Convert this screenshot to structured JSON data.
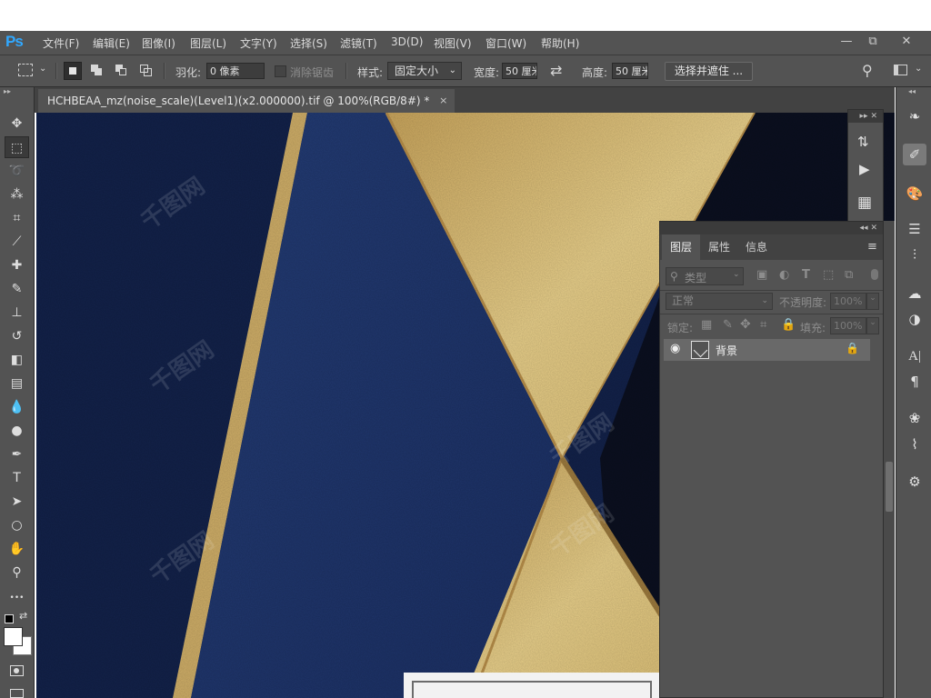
{
  "app": {
    "logo": "Ps"
  },
  "menu": [
    "文件(F)",
    "编辑(E)",
    "图像(I)",
    "图层(L)",
    "文字(Y)",
    "选择(S)",
    "滤镜(T)",
    "3D(D)",
    "视图(V)",
    "窗口(W)",
    "帮助(H)"
  ],
  "window_controls": {
    "minimize": "—",
    "restore": "⧉",
    "close": "✕"
  },
  "options": {
    "feather_label": "羽化:",
    "feather_value": "0 像素",
    "antialias_label": "消除锯齿",
    "style_label": "样式:",
    "style_value": "固定大小",
    "width_label": "宽度:",
    "width_value": "50 厘米",
    "swap_icon": "⇄",
    "height_label": "高度:",
    "height_value": "50 厘米",
    "select_mask_label": "选择并遮住 ..."
  },
  "document": {
    "tab_title": "HCHBEAA_mz(noise_scale)(Level1)(x2.000000).tif @ 100%(RGB/8#) *",
    "close": "×"
  },
  "tools": [
    {
      "name": "move-tool",
      "glyph": "✥"
    },
    {
      "name": "marquee-tool",
      "glyph": "⬚"
    },
    {
      "name": "lasso-tool",
      "glyph": "➰"
    },
    {
      "name": "magic-wand-tool",
      "glyph": "⁂"
    },
    {
      "name": "crop-tool",
      "glyph": "⌗"
    },
    {
      "name": "eyedropper-tool",
      "glyph": "⟋"
    },
    {
      "name": "healing-tool",
      "glyph": "✚"
    },
    {
      "name": "brush-tool",
      "glyph": "✎"
    },
    {
      "name": "stamp-tool",
      "glyph": "⊥"
    },
    {
      "name": "history-brush-tool",
      "glyph": "↺"
    },
    {
      "name": "eraser-tool",
      "glyph": "◧"
    },
    {
      "name": "gradient-tool",
      "glyph": "▤"
    },
    {
      "name": "blur-tool",
      "glyph": "💧"
    },
    {
      "name": "dodge-tool",
      "glyph": "●"
    },
    {
      "name": "pen-tool",
      "glyph": "✒"
    },
    {
      "name": "type-tool",
      "glyph": "T"
    },
    {
      "name": "path-select-tool",
      "glyph": "➤"
    },
    {
      "name": "ellipse-tool",
      "glyph": "○"
    },
    {
      "name": "hand-tool",
      "glyph": "✋"
    },
    {
      "name": "zoom-tool",
      "glyph": "⚲"
    },
    {
      "name": "more-tools",
      "glyph": "•••"
    }
  ],
  "layers_panel": {
    "tabs": [
      "图层",
      "属性",
      "信息"
    ],
    "filter_label": "类型",
    "blend_mode": "正常",
    "opacity_label": "不透明度:",
    "opacity_value": "100%",
    "lock_label": "锁定:",
    "fill_label": "填充:",
    "fill_value": "100%",
    "layer_name": "背景"
  },
  "collapse_glyphs": {
    "expand": "▸▸",
    "collapse": "◂◂",
    "close": "✕",
    "menu": "≡"
  },
  "watermark": "千图网",
  "colors": {
    "ui_dark": "#535353",
    "navy": "#1b2e5e",
    "gold": "#d9b96a",
    "accent": "#31a8ff"
  }
}
